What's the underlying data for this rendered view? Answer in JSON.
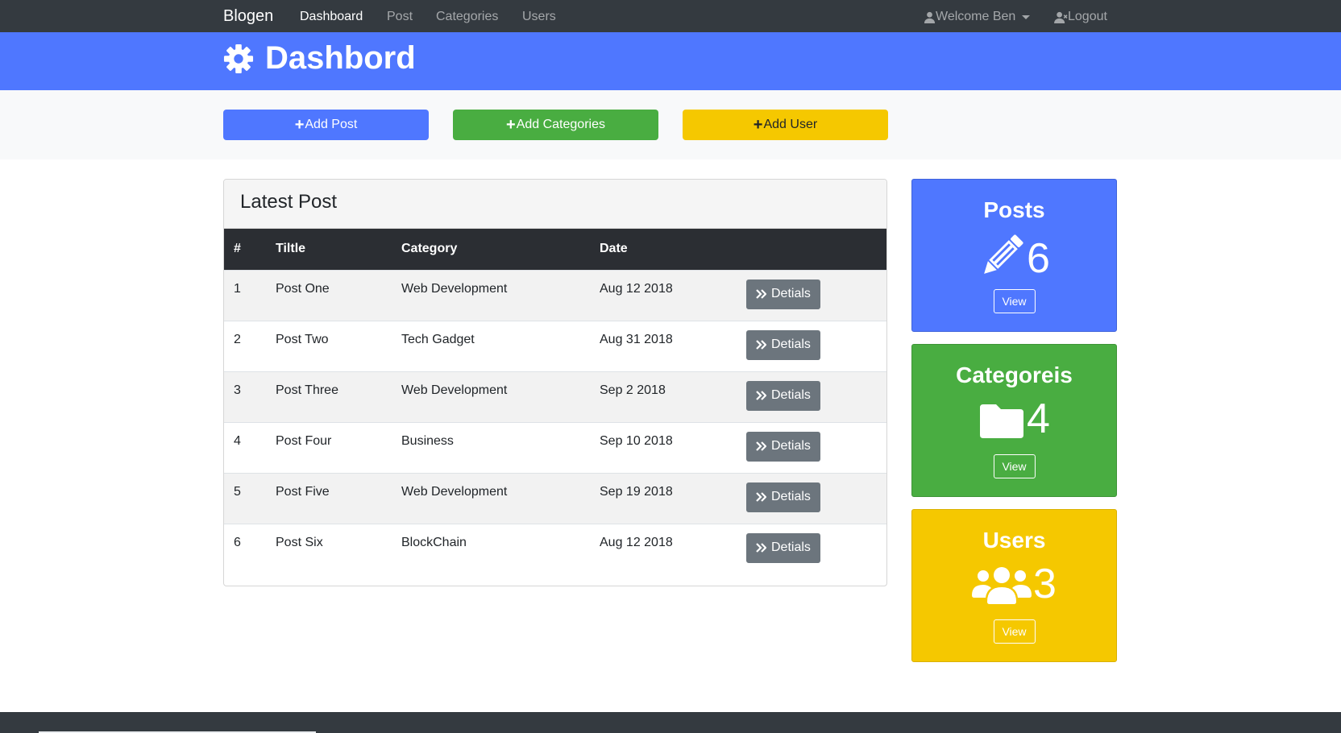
{
  "navbar": {
    "brand": "Blogen",
    "links": [
      {
        "label": "Dashboard",
        "active": true
      },
      {
        "label": "Post",
        "active": false
      },
      {
        "label": "Categories",
        "active": false
      },
      {
        "label": "Users",
        "active": false
      }
    ],
    "welcome": "Welcome Ben",
    "logout": "Logout"
  },
  "header": {
    "title": "Dashbord",
    "icon": "gear-icon"
  },
  "actions": {
    "add_post": "Add Post",
    "add_categories": "Add Categories",
    "add_user": "Add User"
  },
  "latest": {
    "title": "Latest Post",
    "columns": [
      "#",
      "Tiltle",
      "Category",
      "Date"
    ],
    "rows": [
      {
        "num": "1",
        "title": "Post One",
        "category": "Web Development",
        "date": "Aug 12 2018",
        "action": "Detials"
      },
      {
        "num": "2",
        "title": "Post Two",
        "category": "Tech Gadget",
        "date": "Aug 31 2018",
        "action": "Detials"
      },
      {
        "num": "3",
        "title": "Post Three",
        "category": "Web Development",
        "date": "Sep 2 2018",
        "action": "Detials"
      },
      {
        "num": "4",
        "title": "Post Four",
        "category": "Business",
        "date": "Sep 10 2018",
        "action": "Detials"
      },
      {
        "num": "5",
        "title": "Post Five",
        "category": "Web Development",
        "date": "Sep 19 2018",
        "action": "Detials"
      },
      {
        "num": "6",
        "title": "Post Six",
        "category": "BlockChain",
        "date": "Aug 12 2018",
        "action": "Detials"
      }
    ]
  },
  "stats": {
    "posts": {
      "title": "Posts",
      "count": "6",
      "view": "View",
      "icon": "pencil-icon",
      "color": "#4f77ff"
    },
    "categories": {
      "title": "Categoreis",
      "count": "4",
      "view": "View",
      "icon": "folder-icon",
      "color": "#49ad41"
    },
    "users": {
      "title": "Users",
      "count": "3",
      "view": "View",
      "icon": "users-icon",
      "color": "#f5c800"
    }
  }
}
